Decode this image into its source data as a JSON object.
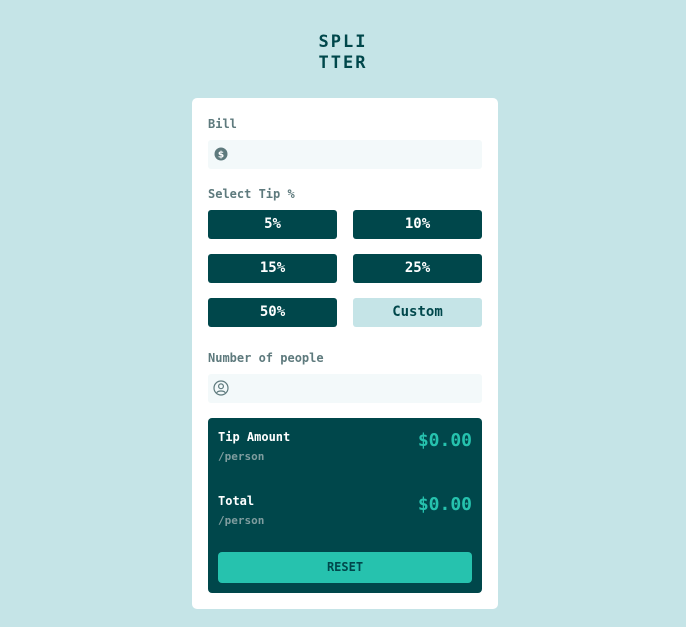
{
  "app": {
    "logo_line1": "SPLI",
    "logo_line2": "TTER"
  },
  "bill": {
    "label": "Bill",
    "value": "",
    "icon": "dollar-icon"
  },
  "tip": {
    "label": "Select Tip %",
    "options": [
      "5%",
      "10%",
      "15%",
      "25%",
      "50%"
    ],
    "custom_placeholder": "Custom"
  },
  "people": {
    "label": "Number of people",
    "value": "",
    "icon": "person-icon"
  },
  "results": {
    "tip_amount_label": "Tip Amount",
    "tip_amount_sub": "/person",
    "tip_amount_value": "$0.00",
    "total_label": "Total",
    "total_sub": "/person",
    "total_value": "$0.00",
    "reset_label": "RESET"
  },
  "colors": {
    "background": "#c5e4e7",
    "dark_cyan": "#00474b",
    "strong_cyan": "#26c2ae",
    "grayish_cyan": "#5e7a7d",
    "light_cyan": "#f3f9fa"
  }
}
